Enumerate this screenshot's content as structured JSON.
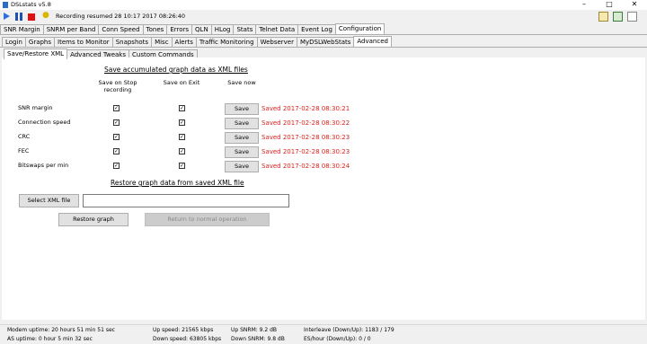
{
  "window": {
    "title": "DSLstats v5.8"
  },
  "toolbar": {
    "status_message": "Recording resumed 28 10:17 2017 08:26:40"
  },
  "main_tabs": [
    "SNR Margin",
    "SNRM per Band",
    "Conn Speed",
    "Tones",
    "Errors",
    "QLN",
    "HLog",
    "Stats",
    "Telnet Data",
    "Event Log",
    "Configuration"
  ],
  "config_tabs": [
    "Login",
    "Graphs",
    "Items to Monitor",
    "Snapshots",
    "Misc",
    "Alerts",
    "Traffic Monitoring",
    "Webserver",
    "MyDSLWebStats",
    "Advanced"
  ],
  "advanced_tabs": [
    "Save/Restore XML",
    "Advanced Tweaks",
    "Custom Commands"
  ],
  "save_section": {
    "heading": "Save accumulated graph data as XML files",
    "col_stop": "Save on Stop recording",
    "col_exit": "Save on Exit",
    "col_now": "Save now",
    "save_label": "Save",
    "rows": [
      {
        "label": "SNR margin",
        "status": "Saved 2017-02-28 08:30:21"
      },
      {
        "label": "Connection speed",
        "status": "Saved 2017-02-28 08:30:22"
      },
      {
        "label": "CRC",
        "status": "Saved 2017-02-28 08:30:23"
      },
      {
        "label": "FEC",
        "status": "Saved 2017-02-28 08:30:23"
      },
      {
        "label": "Bitswaps per min",
        "status": "Saved 2017-02-28 08:30:24"
      }
    ]
  },
  "restore_section": {
    "heading": "Restore graph data from saved XML file",
    "select_label": "Select XML file",
    "file_value": "",
    "restore_label": "Restore graph",
    "return_label": "Return to normal operation"
  },
  "statusbar": {
    "modem_uptime": "Modem uptime:  20 hours 51 min 51 sec",
    "as_uptime": "AS uptime:  0 hour 5 min 32 sec",
    "up_speed": "Up speed: 21565 kbps",
    "down_speed": "Down speed: 63805 kbps",
    "up_snrm": "Up SNRM: 9.2 dB",
    "down_snrm": "Down SNRM: 9.8 dB",
    "interleave": "Interleave (Down/Up):  1183 / 179",
    "es_hour": "ES/hour (Down/Up):  0 / 0"
  },
  "colors": {
    "saved_text": "#e0201a",
    "stop_icon": "#e01010",
    "play_icon": "#2f6fdf"
  }
}
